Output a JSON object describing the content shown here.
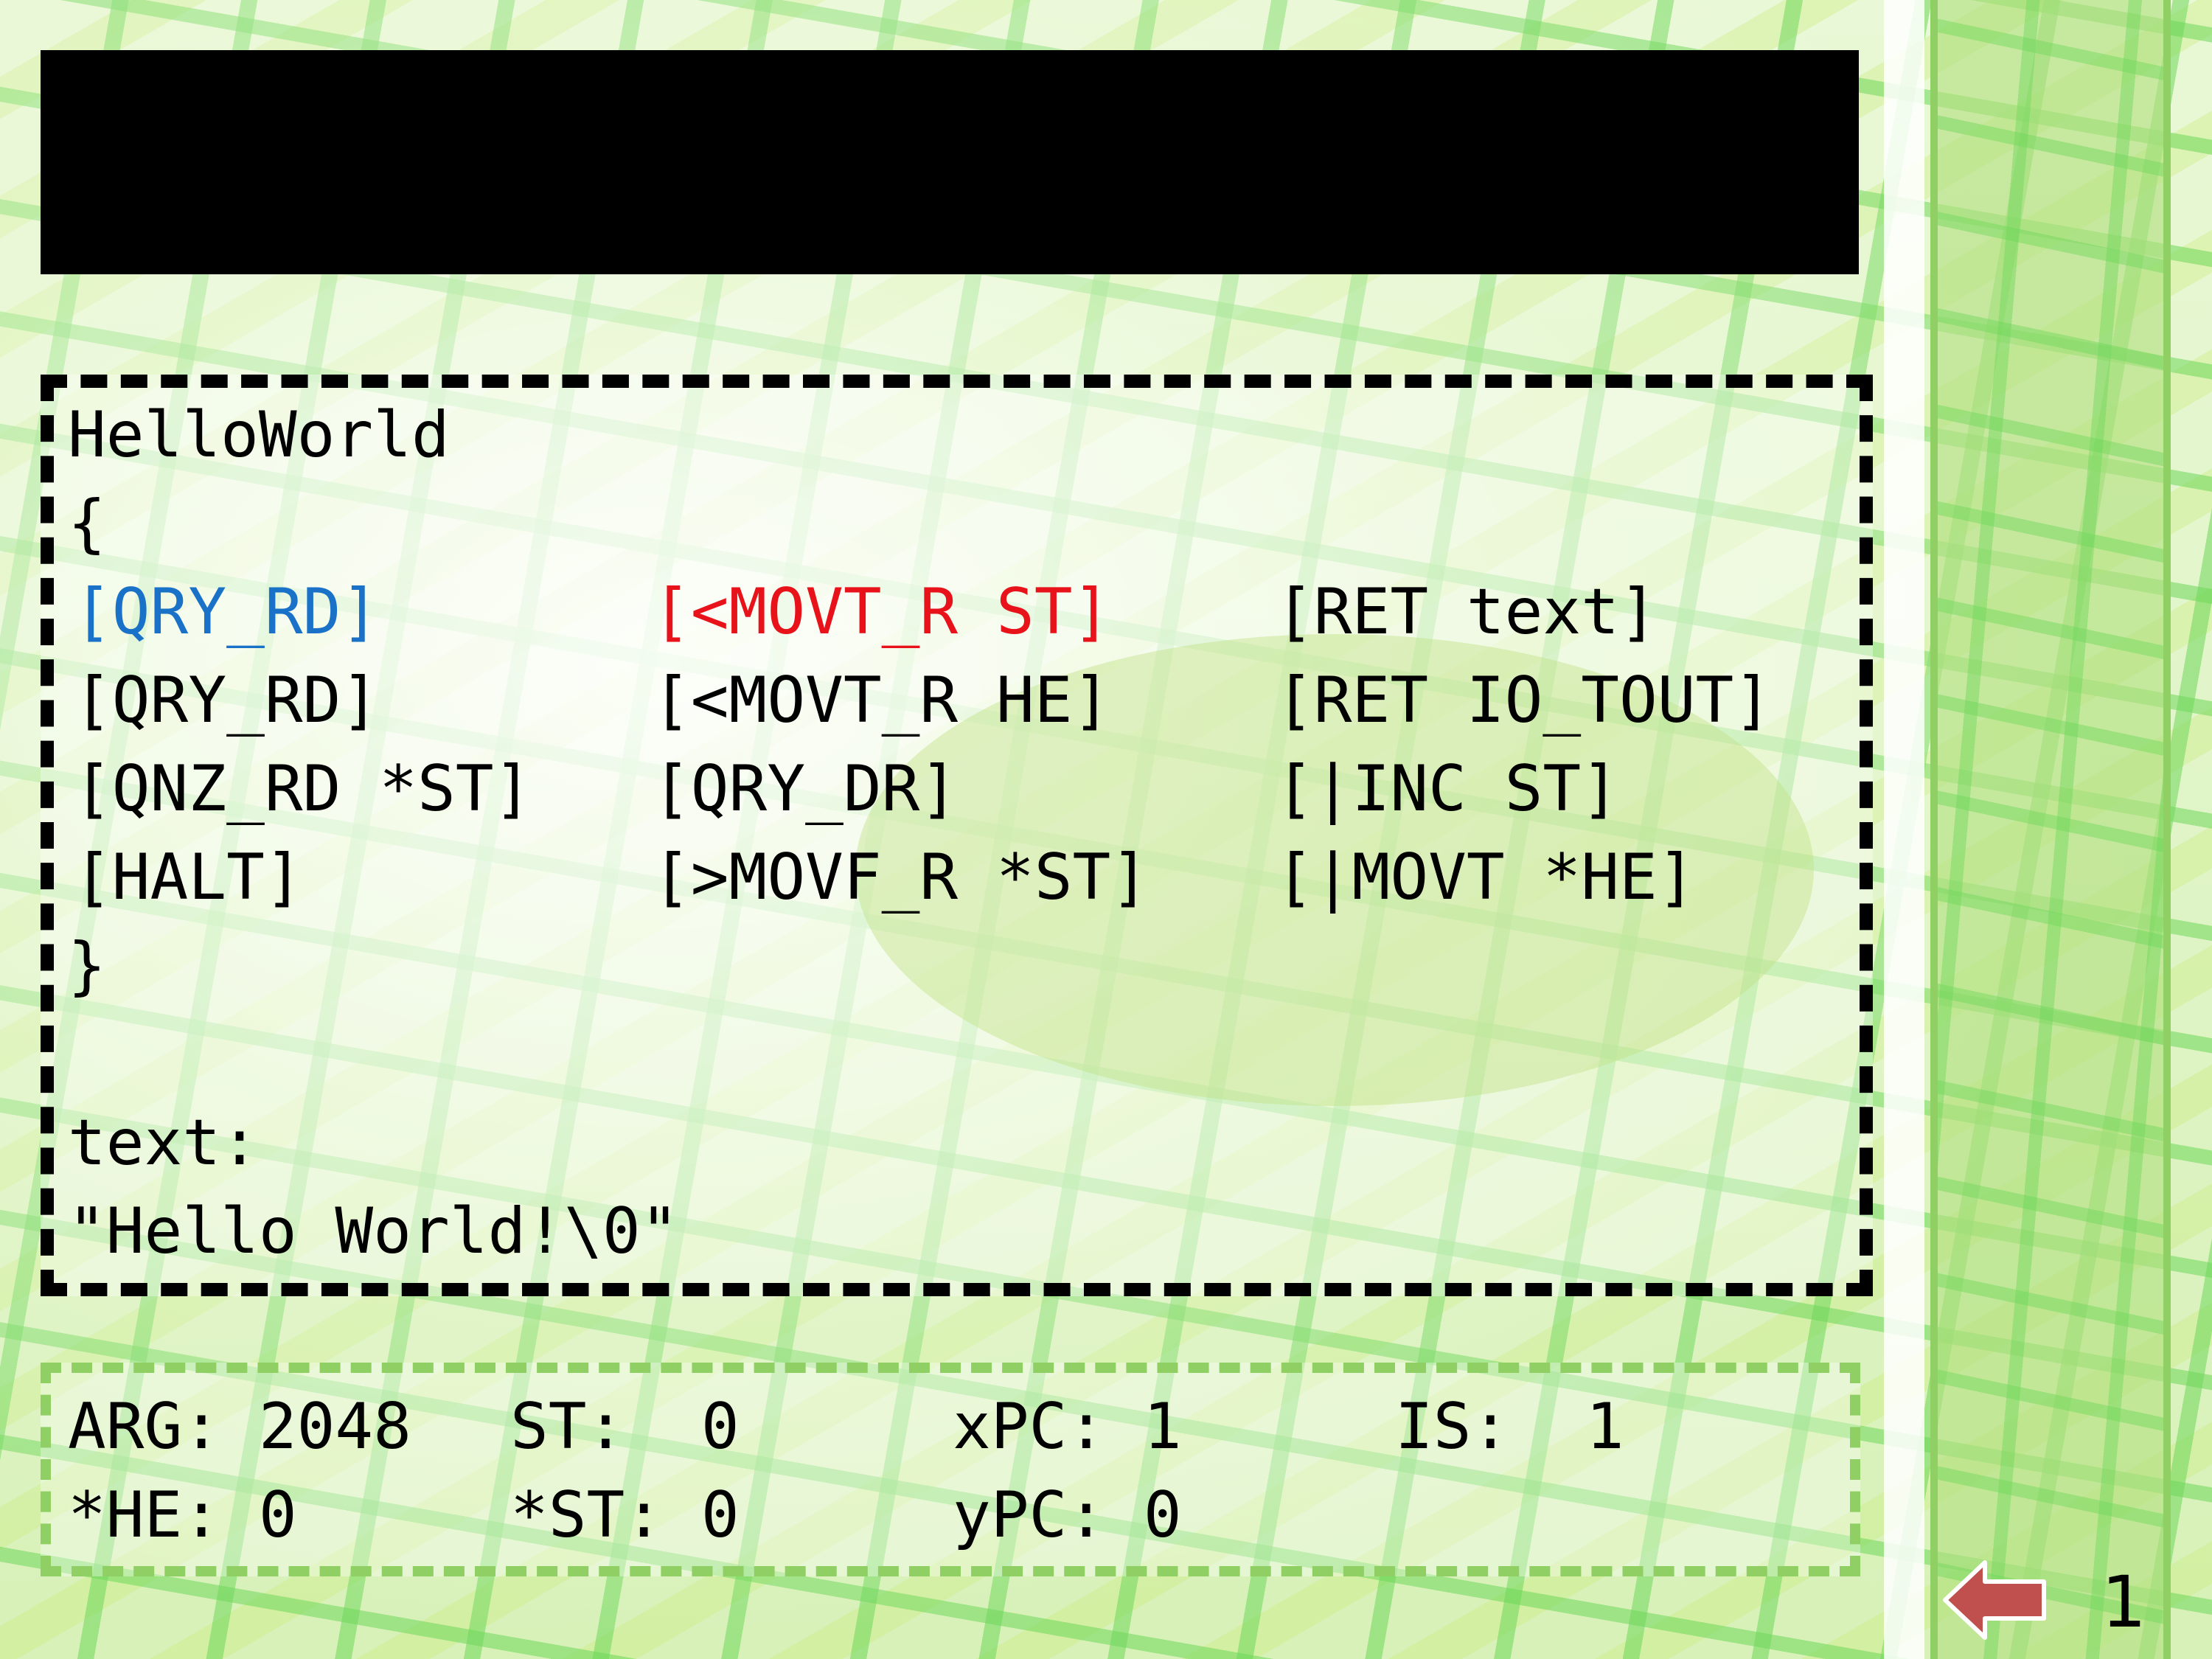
{
  "program": {
    "name": "HelloWorld",
    "open_brace": "{",
    "close_brace": "}",
    "rows": [
      [
        "[QRY_RD]",
        "[<MOVT_R ST]",
        "[RET text]"
      ],
      [
        "[QRY_RD]",
        "[<MOVT_R HE]",
        "[RET IO_TOUT]"
      ],
      [
        "[QNZ_RD *ST]",
        "[QRY_DR]",
        "[|INC ST]"
      ],
      [
        "[HALT]",
        "[>MOVF_R *ST]",
        "[|MOVT *HE]"
      ]
    ],
    "data_label": "text:",
    "data_value": "\"Hello World!\\0\"",
    "highlight_colors": {
      "current": "#1a72c8",
      "active": "#e8121b"
    }
  },
  "registers": {
    "arg": "ARG: 2048",
    "st": "ST:  0",
    "xpc": "xPC: 1",
    "is": "IS:  1",
    "he_ptr": "*HE: 0",
    "st_ptr": "*ST: 0",
    "ypc": "yPC: 0"
  },
  "nav": {
    "back_icon": "left-arrow-icon",
    "page_number": "1"
  },
  "colors": {
    "accent_green": "#8fcf63",
    "back_arrow": "#c0504d"
  }
}
